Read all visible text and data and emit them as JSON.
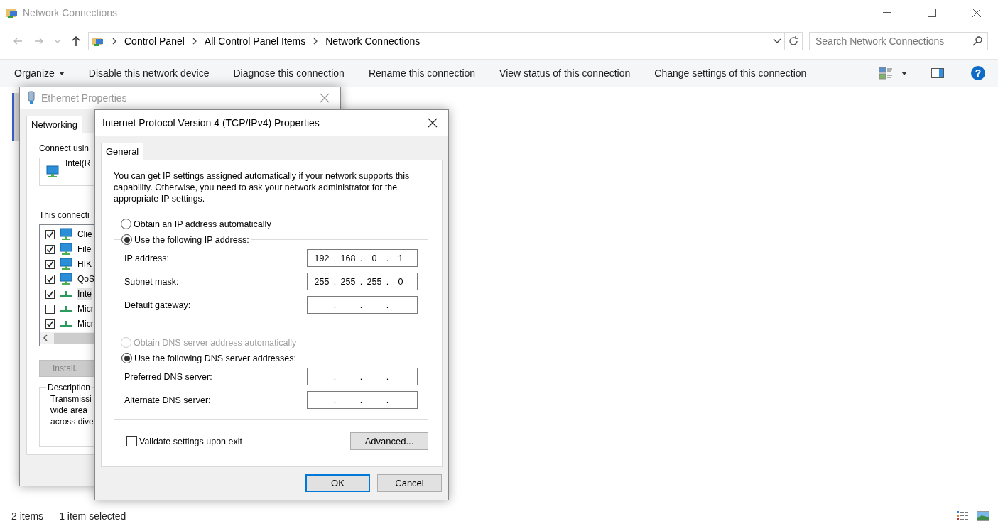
{
  "window": {
    "title": "Network Connections"
  },
  "nav": [
    {
      "kind": "back",
      "disabled": true
    },
    {
      "kind": "forward",
      "disabled": true
    },
    {
      "kind": "recent",
      "disabled": true
    },
    {
      "kind": "up",
      "disabled": false
    }
  ],
  "address_bar": {
    "crumbs": [
      "Control Panel",
      "All Control Panel Items",
      "Network Connections"
    ]
  },
  "search": {
    "placeholder": "Search Network Connections"
  },
  "toolbar": {
    "commands": [
      {
        "label": "Organize",
        "menu": true
      },
      {
        "label": "Disable this network device",
        "menu": false
      },
      {
        "label": "Diagnose this connection",
        "menu": false
      },
      {
        "label": "Rename this connection",
        "menu": false
      },
      {
        "label": "View status of this connection",
        "menu": false
      },
      {
        "label": "Change settings of this connection",
        "menu": false
      }
    ],
    "help": "?"
  },
  "status_bar": {
    "count": "2 items",
    "selection": "1 item selected"
  },
  "ethernet_dialog": {
    "title": "Ethernet Properties",
    "tabs": [
      {
        "label": "Networking",
        "selected": true
      }
    ],
    "connect_using": "Connect usin",
    "adapter": "Intel(R",
    "items_label": "This connecti",
    "items": [
      {
        "kind": "service",
        "label": "Clie",
        "checked": true,
        "selected": false
      },
      {
        "kind": "service",
        "label": "File",
        "checked": true,
        "selected": false
      },
      {
        "kind": "service",
        "label": "HIK",
        "checked": true,
        "selected": false
      },
      {
        "kind": "service",
        "label": "QoS",
        "checked": true,
        "selected": false
      },
      {
        "kind": "protocol",
        "label": "Inte",
        "checked": true,
        "selected": true
      },
      {
        "kind": "protocol",
        "label": "Micr",
        "checked": false,
        "selected": false
      },
      {
        "kind": "protocol",
        "label": "Micr",
        "checked": true,
        "selected": false
      }
    ],
    "install": "Install.",
    "description": {
      "title": "Description",
      "lines": [
        "Transmissi",
        "wide area",
        "across dive"
      ]
    }
  },
  "ipv4_dialog": {
    "title": "Internet Protocol Version 4 (TCP/IPv4) Properties",
    "tabs": [
      {
        "label": "General",
        "selected": true
      }
    ],
    "intro": "You can get IP settings assigned automatically if your network supports this capability. Otherwise, you need to ask your network administrator for the appropriate IP settings.",
    "ip": {
      "auto": {
        "label": "Obtain an IP address automatically",
        "selected": false,
        "disabled": false
      },
      "manual": {
        "label": "Use the following IP address:",
        "selected": true,
        "disabled": false
      },
      "fields": [
        {
          "label": "IP address:",
          "octets": [
            "192",
            "168",
            "0",
            "1"
          ],
          "dots": [
            ".",
            ".",
            "."
          ]
        },
        {
          "label": "Subnet mask:",
          "octets": [
            "255",
            "255",
            "255",
            "0"
          ],
          "dots": [
            ".",
            ".",
            "."
          ]
        },
        {
          "label": "Default gateway:",
          "dots": [
            ".",
            ".",
            "."
          ]
        }
      ]
    },
    "dns": {
      "auto": {
        "label": "Obtain DNS server address automatically",
        "selected": false,
        "disabled": true
      },
      "manual": {
        "label": "Use the following DNS server addresses:",
        "selected": true,
        "disabled": false
      },
      "fields": [
        {
          "label": "Preferred DNS server:",
          "dots": [
            ".",
            ".",
            "."
          ]
        },
        {
          "label": "Alternate DNS server:",
          "dots": [
            ".",
            ".",
            "."
          ]
        }
      ]
    },
    "validate": {
      "label": "Validate settings upon exit",
      "checked": false
    },
    "advanced": "Advanced...",
    "buttons": [
      {
        "label": "OK",
        "default": true
      },
      {
        "label": "Cancel",
        "default": false
      }
    ]
  }
}
